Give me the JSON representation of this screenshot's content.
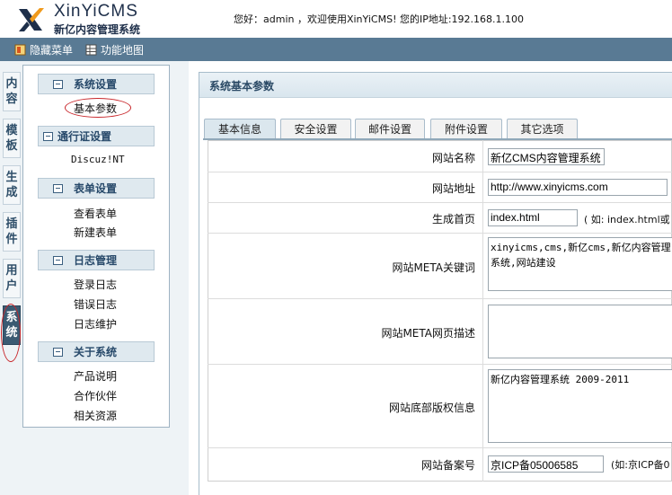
{
  "header": {
    "logo_en": "XinYiCMS",
    "logo_cn": "新亿内容管理系统",
    "welcome": "您好：admin ，欢迎使用XinYiCMS!  您的IP地址:192.168.1.100"
  },
  "topbar": {
    "hide_menu": "隐藏菜单",
    "site_map": "功能地图"
  },
  "vtabs": [
    "内容",
    "模板",
    "生成",
    "插件",
    "用户",
    "系统"
  ],
  "menu": {
    "sections": [
      {
        "title": "系统设置",
        "items": [
          "基本参数"
        ]
      },
      {
        "title": "通行证设置",
        "items": [
          "Discuz!NT"
        ]
      },
      {
        "title": "表单设置",
        "items": [
          "查看表单",
          "新建表单"
        ]
      },
      {
        "title": "日志管理",
        "items": [
          "登录日志",
          "错误日志",
          "日志维护"
        ]
      },
      {
        "title": "关于系统",
        "items": [
          "产品说明",
          "合作伙伴",
          "相关资源"
        ]
      }
    ]
  },
  "content": {
    "section_title": "系统基本参数",
    "tabs": [
      "基本信息",
      "安全设置",
      "邮件设置",
      "附件设置",
      "其它选项"
    ],
    "fields": {
      "site_name": {
        "label": "网站名称",
        "value": "新亿CMS内容管理系统"
      },
      "site_url": {
        "label": "网站地址",
        "value": "http://www.xinyicms.com"
      },
      "home_page": {
        "label": "生成首页",
        "value": "index.html",
        "hint": "( 如: index.html或"
      },
      "meta_keywords": {
        "label": "网站META关键词",
        "value": "xinyicms,cms,新亿cms,新亿内容管理系统,网站建设"
      },
      "meta_desc": {
        "label": "网站META网页描述",
        "value": ""
      },
      "copyright": {
        "label": "网站底部版权信息",
        "value": "新亿内容管理系统 2009-2011"
      },
      "icp": {
        "label": "网站备案号",
        "value": "京ICP备05006585",
        "hint": "(如:京ICP备0"
      }
    }
  },
  "colors": {
    "topbar": "#597a94",
    "accent": "#27496a",
    "highlight": "#c8262a"
  }
}
